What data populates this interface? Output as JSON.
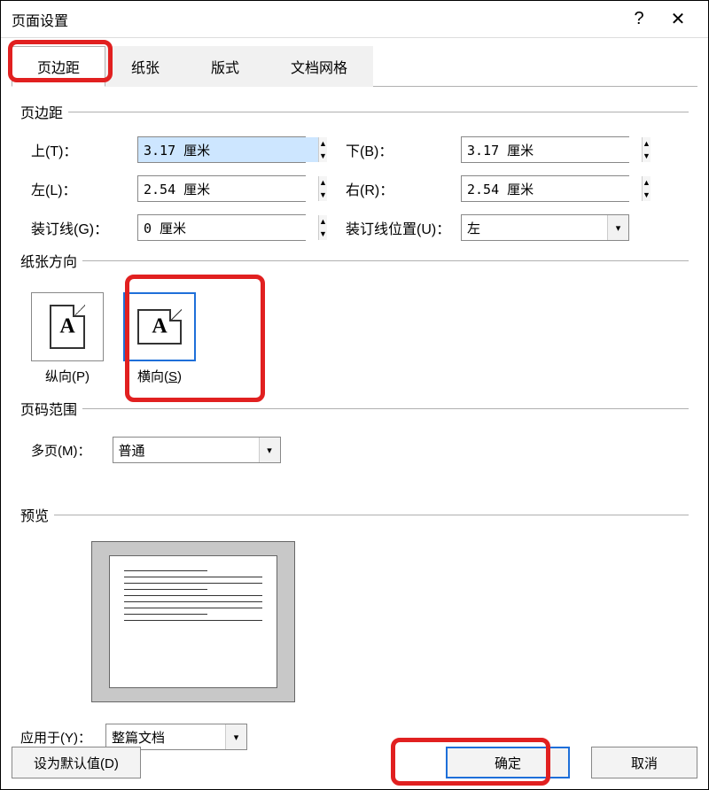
{
  "title": "页面设置",
  "titlebar": {
    "help": "?",
    "close": "✕"
  },
  "tabs": [
    "页边距",
    "纸张",
    "版式",
    "文档网格"
  ],
  "active_tab_index": 0,
  "margins": {
    "legend": "页边距",
    "top_label": "上(T)：",
    "top_value": "3.17 厘米",
    "bottom_label": "下(B)：",
    "bottom_value": "3.17 厘米",
    "left_label": "左(L)：",
    "left_value": "2.54 厘米",
    "right_label": "右(R)：",
    "right_value": "2.54 厘米",
    "gutter_label": "装订线(G)：",
    "gutter_value": "0 厘米",
    "gutter_pos_label": "装订线位置(U)：",
    "gutter_pos_value": "左"
  },
  "orientation": {
    "legend": "纸张方向",
    "portrait_label": "纵向(P)",
    "landscape_label": "横向(S)",
    "selected": "landscape"
  },
  "pages": {
    "legend": "页码范围",
    "multi_label": "多页(M)：",
    "multi_value": "普通"
  },
  "preview": {
    "legend": "预览"
  },
  "apply": {
    "label": "应用于(Y)：",
    "value": "整篇文档"
  },
  "buttons": {
    "default": "设为默认值(D)",
    "ok": "确定",
    "cancel": "取消"
  },
  "highlights": {
    "accent": "#e12020",
    "select": "#1e6fd9"
  }
}
